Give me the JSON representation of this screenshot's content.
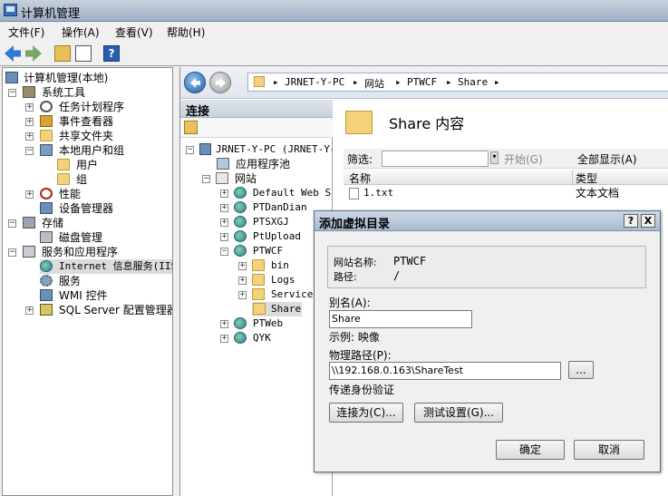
{
  "window": {
    "title": "计算机管理"
  },
  "menu": [
    "文件(F)",
    "操作(A)",
    "查看(V)",
    "帮助(H)"
  ],
  "left_tree": [
    {
      "label": "计算机管理(本地)",
      "icon": "computer-icon"
    },
    {
      "label": "系统工具",
      "icon": "tools-icon"
    },
    {
      "label": "任务计划程序",
      "icon": "clock-icon"
    },
    {
      "label": "事件查看器",
      "icon": "event-viewer-icon"
    },
    {
      "label": "共享文件夹",
      "icon": "shared-folder-icon"
    },
    {
      "label": "本地用户和组",
      "icon": "users-icon"
    },
    {
      "label": "用户",
      "icon": "folder-icon"
    },
    {
      "label": "组",
      "icon": "folder-icon"
    },
    {
      "label": "性能",
      "icon": "performance-icon"
    },
    {
      "label": "设备管理器",
      "icon": "device-manager-icon"
    },
    {
      "label": "存储",
      "icon": "storage-icon"
    },
    {
      "label": "磁盘管理",
      "icon": "disk-icon"
    },
    {
      "label": "服务和应用程序",
      "icon": "services-apps-icon"
    },
    {
      "label": "Internet 信息服务(IIS",
      "icon": "iis-icon"
    },
    {
      "label": "服务",
      "icon": "gear-icon"
    },
    {
      "label": "WMI 控件",
      "icon": "wmi-icon"
    },
    {
      "label": "SQL Server 配置管理器",
      "icon": "sql-server-icon"
    }
  ],
  "address": [
    "JRNET-Y-PC",
    "网站",
    "PTWCF",
    "Share"
  ],
  "connections": {
    "header": "连接",
    "items": [
      "JRNET-Y-PC (JRNET-Y-",
      "应用程序池",
      "网站",
      "Default Web S:",
      "PTDanDian",
      "PTSXGJ",
      "PtUpload",
      "PTWCF",
      "bin",
      "Logs",
      "Services",
      "Share",
      "PTWeb",
      "QYK"
    ]
  },
  "content": {
    "title": "Share 内容",
    "filter_label": "筛选:",
    "start_label": "开始(G)",
    "show_all_label": "全部显示(A)",
    "columns": [
      "名称",
      "类型"
    ],
    "rows": [
      {
        "name": "1.txt",
        "type": "文本文档"
      }
    ]
  },
  "dialog": {
    "title": "添加虚拟目录",
    "help": "?",
    "close": "X",
    "site_name_label": "网站名称:",
    "site_name_value": "PTWCF",
    "path_label": "路径:",
    "path_value": "/",
    "alias_label": "别名(A):",
    "alias_value": "Share",
    "example_label": "示例: 映像",
    "physical_path_label": "物理路径(P):",
    "physical_path_value": "\\\\192.168.0.163\\ShareTest",
    "browse_label": "...",
    "pass_through_label": "传递身份验证",
    "connect_as_label": "连接为(C)...",
    "test_settings_label": "测试设置(G)...",
    "ok_label": "确定",
    "cancel_label": "取消"
  }
}
